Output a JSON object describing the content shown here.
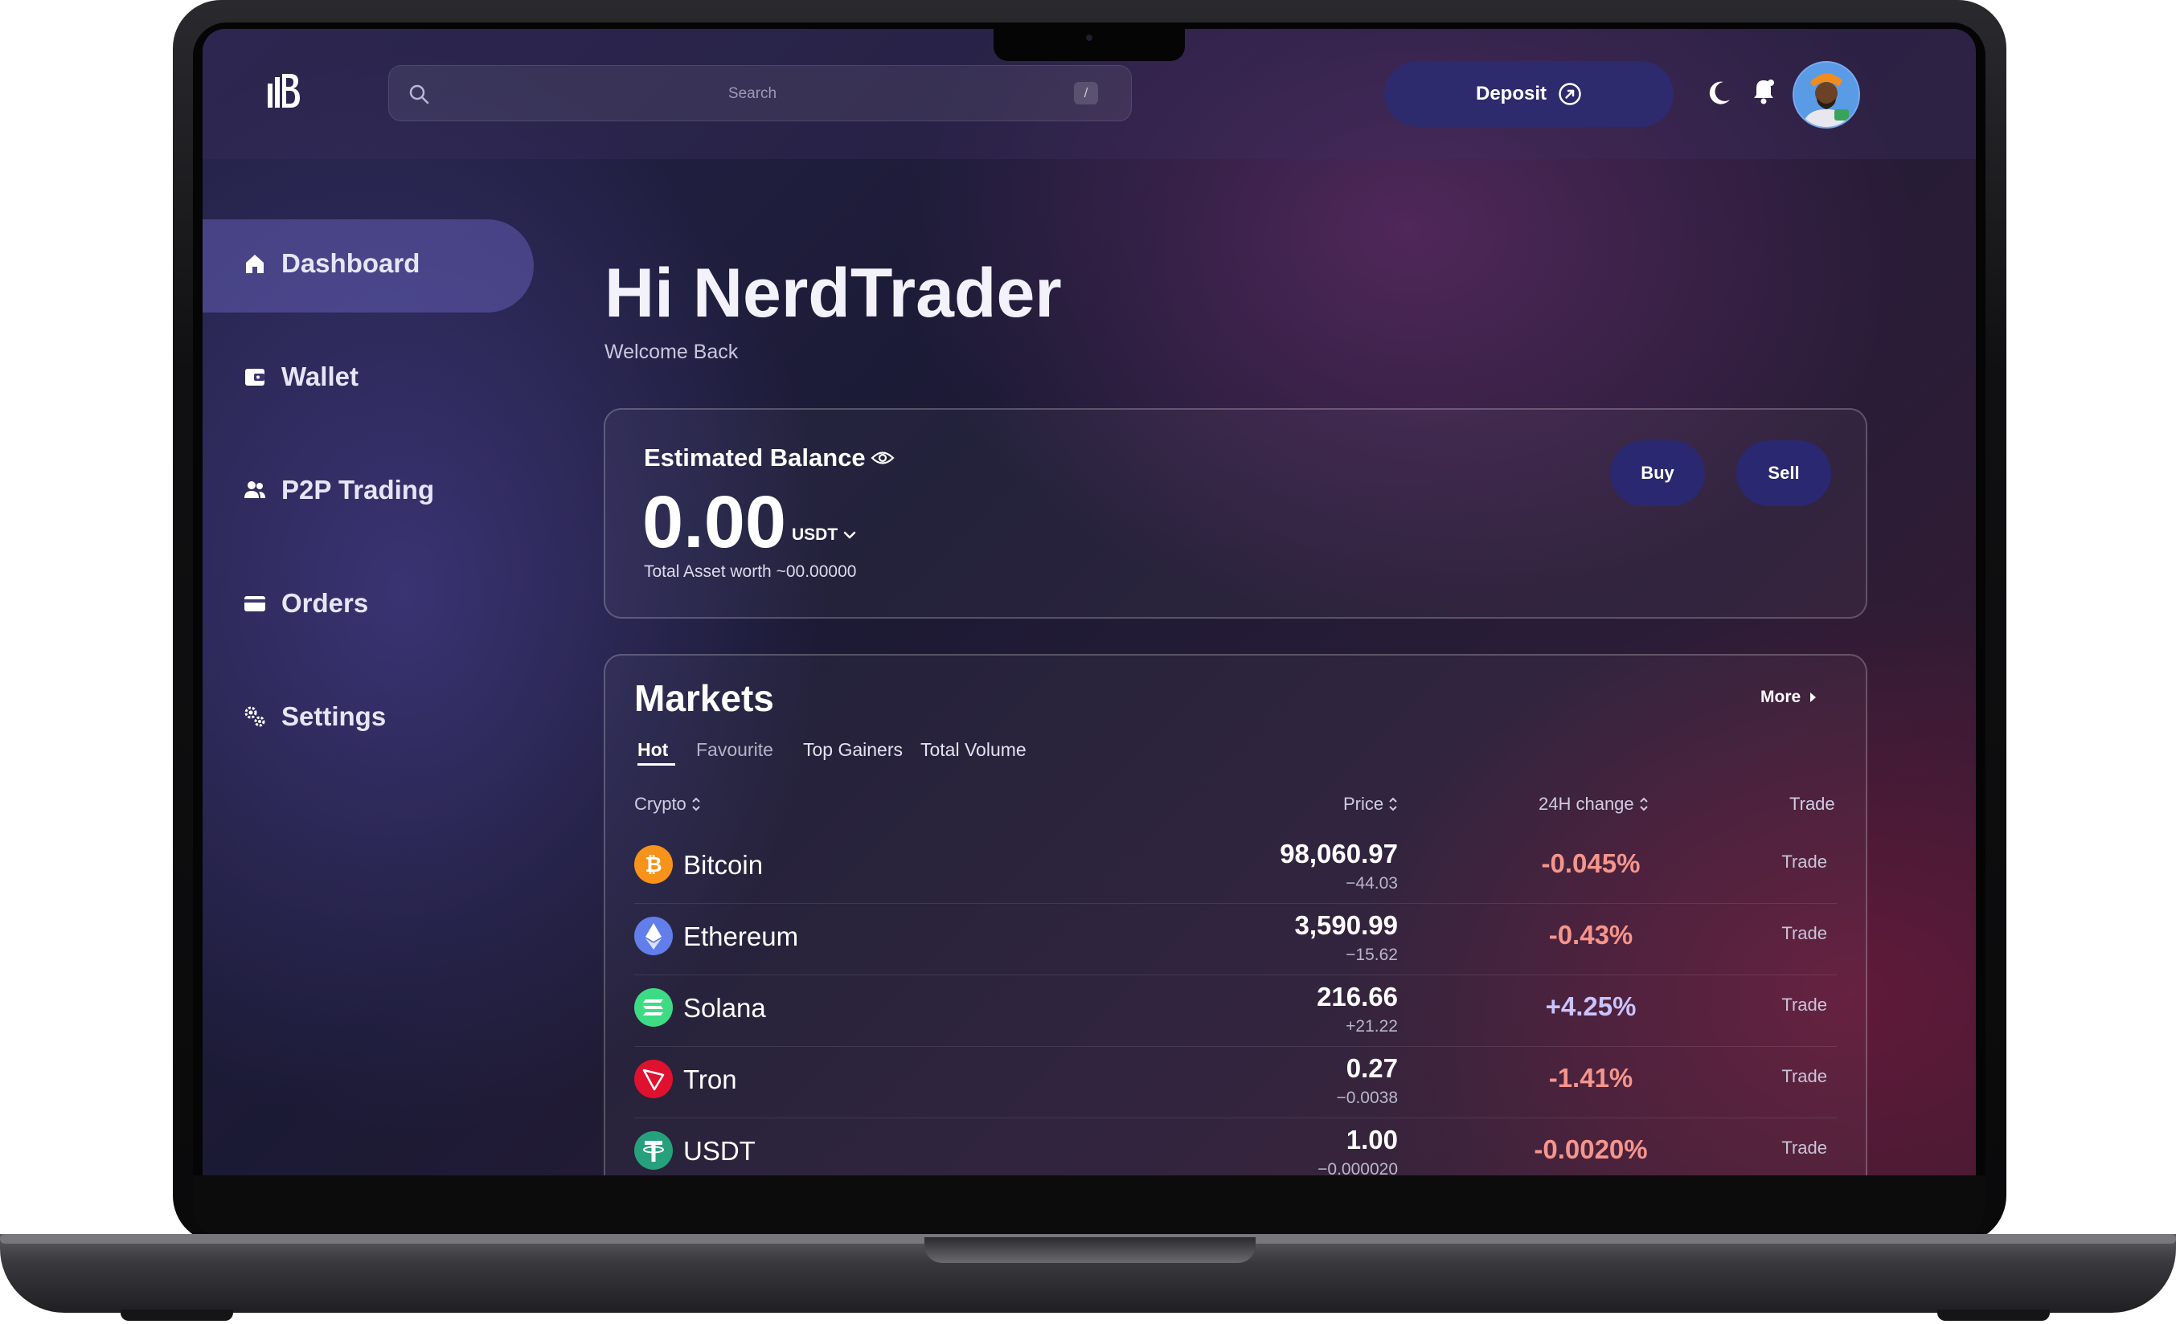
{
  "colors": {
    "accent": "#2d2a6e",
    "negative": "#f6958b",
    "positive": "#c9c3ff",
    "bitcoin": "#f7931a",
    "ethereum": "#627eea",
    "solana": "#3ddc84",
    "tron": "#e0102f",
    "usdt": "#26a17b"
  },
  "header": {
    "logo_icon": "ib-logo-icon",
    "search": {
      "placeholder": "Search",
      "shortcut": "/"
    },
    "deposit_label": "Deposit",
    "icons": [
      "moon-icon",
      "bell-icon"
    ]
  },
  "sidebar": {
    "items": [
      {
        "label": "Dashboard",
        "icon": "home-icon",
        "active": true
      },
      {
        "label": "Wallet",
        "icon": "wallet-icon",
        "active": false
      },
      {
        "label": "P2P Trading",
        "icon": "users-icon",
        "active": false
      },
      {
        "label": "Orders",
        "icon": "card-icon",
        "active": false
      },
      {
        "label": "Settings",
        "icon": "gears-icon",
        "active": false
      }
    ]
  },
  "main": {
    "greeting": "Hi NerdTrader",
    "welcome": "Welcome Back",
    "balance": {
      "title": "Estimated Balance",
      "amount": "0.00",
      "currency": "USDT",
      "subtitle": "Total Asset worth ~00.00000",
      "buy_label": "Buy",
      "sell_label": "Sell"
    },
    "markets": {
      "title": "Markets",
      "more_label": "More",
      "tabs": [
        "Hot",
        "Favourite",
        "Top Gainers",
        "Total Volume"
      ],
      "active_tab": "Hot",
      "columns": [
        "Crypto",
        "Price",
        "24H change",
        "Trade"
      ],
      "rows": [
        {
          "name": "Bitcoin",
          "price": "98,060.97",
          "change": "−44.03",
          "pct": "-0.045%",
          "trade": "Trade"
        },
        {
          "name": "Ethereum",
          "price": "3,590.99",
          "change": "−15.62",
          "pct": "-0.43%",
          "trade": "Trade"
        },
        {
          "name": "Solana",
          "price": "216.66",
          "change": "+21.22",
          "pct": "+4.25%",
          "trade": "Trade"
        },
        {
          "name": "Tron",
          "price": "0.27",
          "change": "−0.0038",
          "pct": "-1.41%",
          "trade": "Trade"
        },
        {
          "name": "USDT",
          "price": "1.00",
          "change": "−0.000020",
          "pct": "-0.0020%",
          "trade": "Trade"
        }
      ]
    }
  }
}
